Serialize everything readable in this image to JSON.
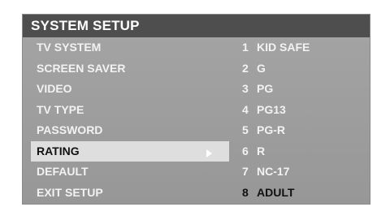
{
  "osd": {
    "title": "SYSTEM SETUP",
    "menu_items": [
      {
        "label": "TV SYSTEM"
      },
      {
        "label": "SCREEN SAVER"
      },
      {
        "label": "VIDEO"
      },
      {
        "label": "TV TYPE"
      },
      {
        "label": "PASSWORD"
      },
      {
        "label": "RATING",
        "selected": true
      },
      {
        "label": "DEFAULT"
      },
      {
        "label": "EXIT  SETUP"
      }
    ],
    "rating_options": [
      {
        "num": "1",
        "label": "KID SAFE"
      },
      {
        "num": "2",
        "label": "G"
      },
      {
        "num": "3",
        "label": "PG"
      },
      {
        "num": "4",
        "label": "PG13"
      },
      {
        "num": "5",
        "label": "PG-R"
      },
      {
        "num": "6",
        "label": "R"
      },
      {
        "num": "7",
        "label": "NC-17"
      },
      {
        "num": "8",
        "label": "ADULT",
        "selected": true
      }
    ],
    "pointer_icon": "right-triangle-icon",
    "colors": {
      "title_bar": "#4e4e4e",
      "panel": "#9d9d9d",
      "highlight": "#dedede",
      "text": "#f2f2f2",
      "selected_text": "#111111"
    }
  }
}
